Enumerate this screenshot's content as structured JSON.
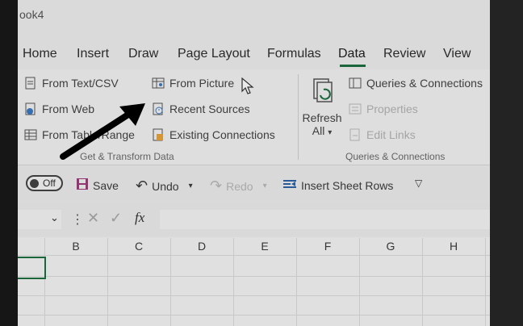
{
  "window": {
    "title_fragment": "ook4"
  },
  "ribbon": {
    "tabs": [
      "Home",
      "Insert",
      "Draw",
      "Page Layout",
      "Formulas",
      "Data",
      "Review",
      "View"
    ],
    "active_tab": "Data",
    "get_transform": {
      "from_text_csv": "From Text/CSV",
      "from_web": "From Web",
      "from_table_range": "From Table/Range",
      "from_picture": "From Picture",
      "recent_sources": "Recent Sources",
      "existing_connections": "Existing Connections",
      "group_label": "Get & Transform Data"
    },
    "queries": {
      "refresh_all_line1": "Refresh",
      "refresh_all_line2": "All",
      "queries_connections": "Queries & Connections",
      "properties": "Properties",
      "edit_links": "Edit Links",
      "group_label": "Queries & Connections"
    }
  },
  "qat": {
    "autosave_state": "Off",
    "save": "Save",
    "undo": "Undo",
    "redo": "Redo",
    "insert_sheet_rows": "Insert Sheet Rows"
  },
  "formula_bar": {
    "fx_label": "fx",
    "value": ""
  },
  "grid": {
    "columns": [
      "B",
      "C",
      "D",
      "E",
      "F",
      "G",
      "H"
    ]
  },
  "colors": {
    "accent_green": "#1d6e3f",
    "annotation_arrow": "#000000"
  }
}
